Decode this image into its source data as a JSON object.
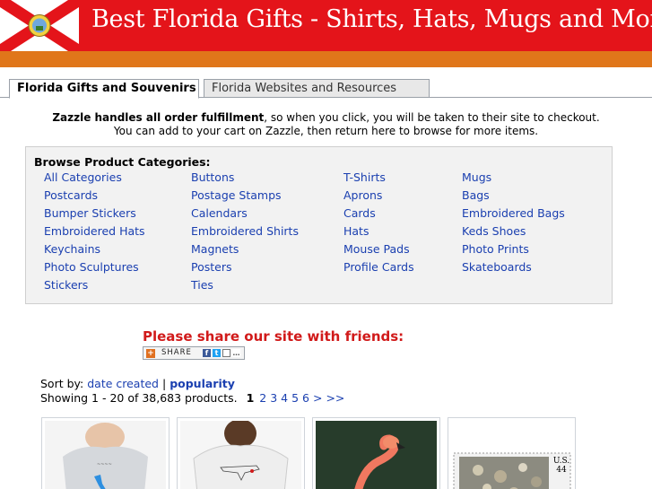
{
  "header": {
    "title": "Best Florida Gifts - Shirts, Hats, Mugs and More!",
    "flag_icon": "florida-flag-icon",
    "colors": {
      "header_red": "#e4141a",
      "orange_bar": "#e0761a"
    }
  },
  "tabs": [
    {
      "label": "Florida Gifts and Souvenirs",
      "active": true
    },
    {
      "label": "Florida Websites and Resources",
      "active": false
    }
  ],
  "notice": {
    "bold": "Zazzle handles all order fulfillment",
    "rest1": ", so when you click, you will be taken to their site to checkout.",
    "line2": "You can add to your cart on Zazzle, then return here to browse for more items."
  },
  "categories": {
    "heading": "Browse Product Categories:",
    "columns": [
      [
        "All Categories",
        "Postcards",
        "Bumper Stickers",
        "Embroidered Hats",
        "Keychains",
        "Photo Sculptures",
        "Stickers"
      ],
      [
        "Buttons",
        "Postage Stamps",
        "Calendars",
        "Embroidered Shirts",
        "Magnets",
        "Posters",
        "Ties"
      ],
      [
        "T-Shirts",
        "Aprons",
        "Cards",
        "Hats",
        "Mouse Pads",
        "Profile Cards"
      ],
      [
        "Mugs",
        "Bags",
        "Embroidered Bags",
        "Keds Shoes",
        "Photo Prints",
        "Skateboards"
      ]
    ]
  },
  "share": {
    "heading": "Please share our site with friends:",
    "button_label": "SHARE"
  },
  "sort": {
    "label": "Sort by:",
    "option_date": "date created",
    "separator": "|",
    "option_popularity": "popularity"
  },
  "showing": {
    "text": "Showing 1 - 20 of 38,683 products.",
    "current_page": "1",
    "pages": [
      "2",
      "3",
      "4",
      "5",
      "6"
    ],
    "next": ">",
    "last": ">>"
  },
  "products": [
    {
      "icon": "kids-tshirt-florida-thumbnail"
    },
    {
      "icon": "tshirt-model-thumbnail"
    },
    {
      "icon": "flamingo-photo-thumbnail"
    },
    {
      "icon": "postage-stamp-seashells-thumbnail",
      "stamp_text": "U.S. 44"
    }
  ]
}
